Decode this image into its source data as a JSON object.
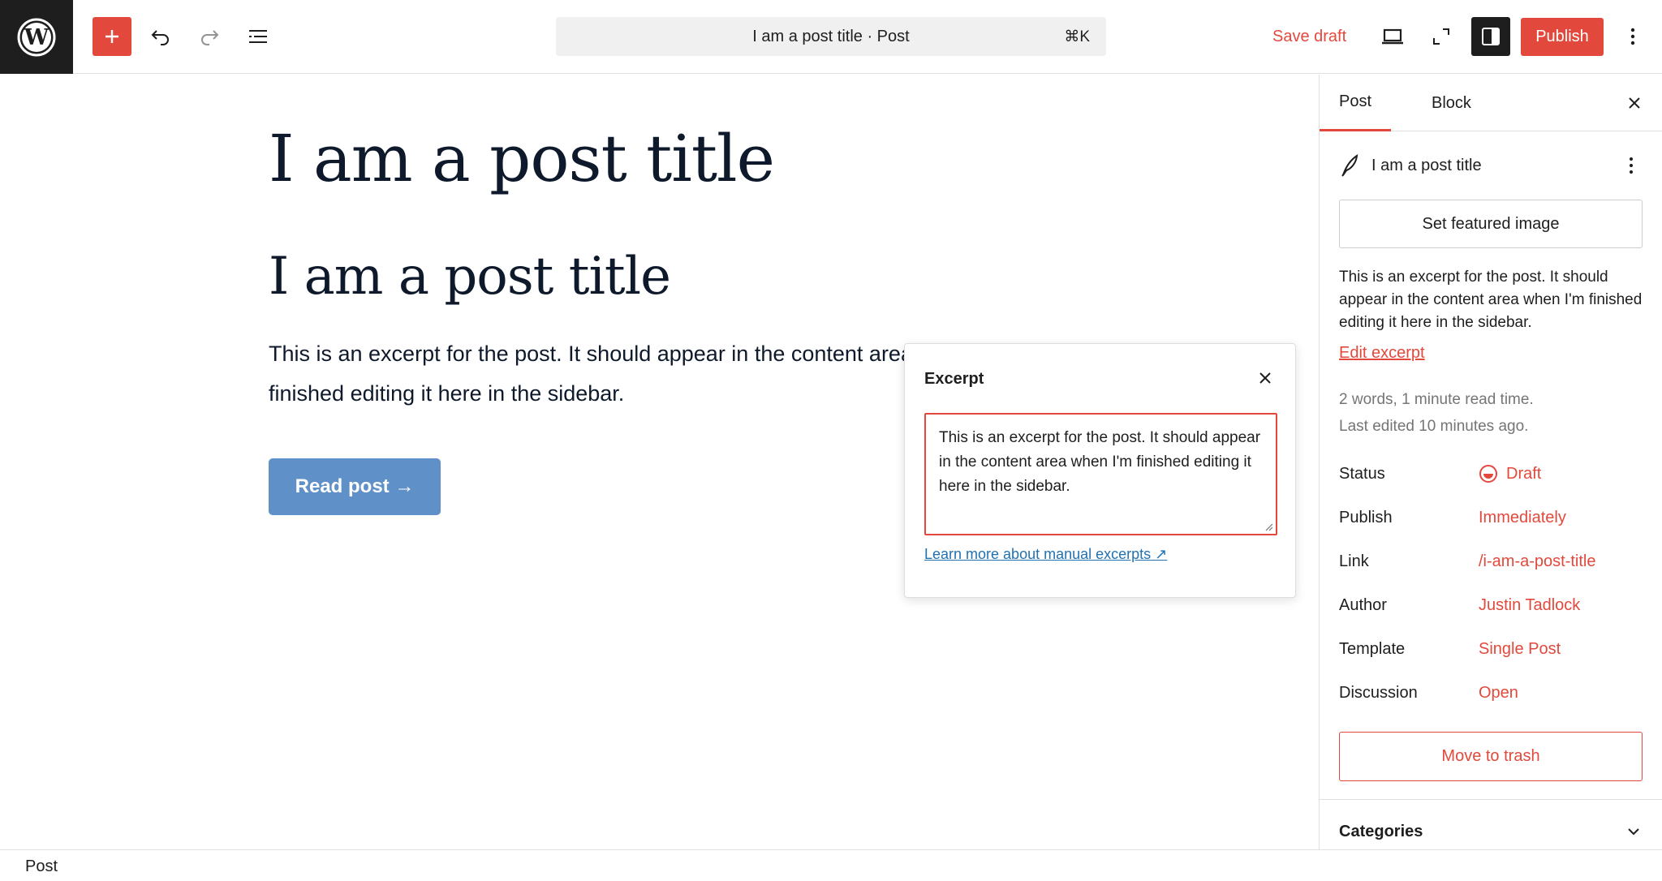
{
  "header": {
    "command_bar_text": "I am a post title · Post",
    "command_shortcut": "⌘K",
    "save_draft_label": "Save draft",
    "publish_label": "Publish"
  },
  "canvas": {
    "title_1": "I am a post title",
    "title_2": "I am a post title",
    "excerpt": "This is an excerpt for the post. It should appear in the content area when I'm finished editing it here in the sidebar.",
    "read_post_label": "Read post →"
  },
  "excerpt_popover": {
    "title": "Excerpt",
    "textarea_value": "This is an excerpt for the post. It should appear in the content area when I'm finished editing it here in the sidebar.",
    "learn_more_link": "Learn more about manual excerpts ↗"
  },
  "sidebar": {
    "tabs": [
      {
        "label": "Post",
        "active": true
      },
      {
        "label": "Block",
        "active": false
      }
    ],
    "post_name": "I am a post title",
    "featured_image_label": "Set featured image",
    "excerpt": "This is an excerpt for the post. It should appear in the content area when I'm finished editing it here in the sidebar.",
    "edit_excerpt_label": "Edit excerpt",
    "meta_line_1": "2 words, 1 minute read time.",
    "meta_line_2": "Last edited 10 minutes ago.",
    "fields": [
      {
        "label": "Status",
        "value": "Draft"
      },
      {
        "label": "Publish",
        "value": "Immediately"
      },
      {
        "label": "Link",
        "value": "/i-am-a-post-title"
      },
      {
        "label": "Author",
        "value": "Justin Tadlock"
      },
      {
        "label": "Template",
        "value": "Single Post"
      },
      {
        "label": "Discussion",
        "value": "Open"
      }
    ],
    "trash_label": "Move to trash",
    "categories_label": "Categories"
  },
  "footer": {
    "breadcrumb": "Post"
  },
  "colors": {
    "accent": "#e2493c",
    "link_blue": "#2271b1",
    "button_blue": "#5f90c7",
    "dark": "#1e1e1e"
  },
  "icons": [
    "wordpress-logo-icon",
    "plus-icon",
    "undo-icon",
    "redo-icon",
    "list-view-icon",
    "desktop-preview-icon",
    "fullscreen-icon",
    "sidebar-settings-icon",
    "kebab-menu-icon",
    "close-icon",
    "quill-icon",
    "draft-status-icon",
    "chevron-down-icon",
    "resize-grip-icon"
  ]
}
